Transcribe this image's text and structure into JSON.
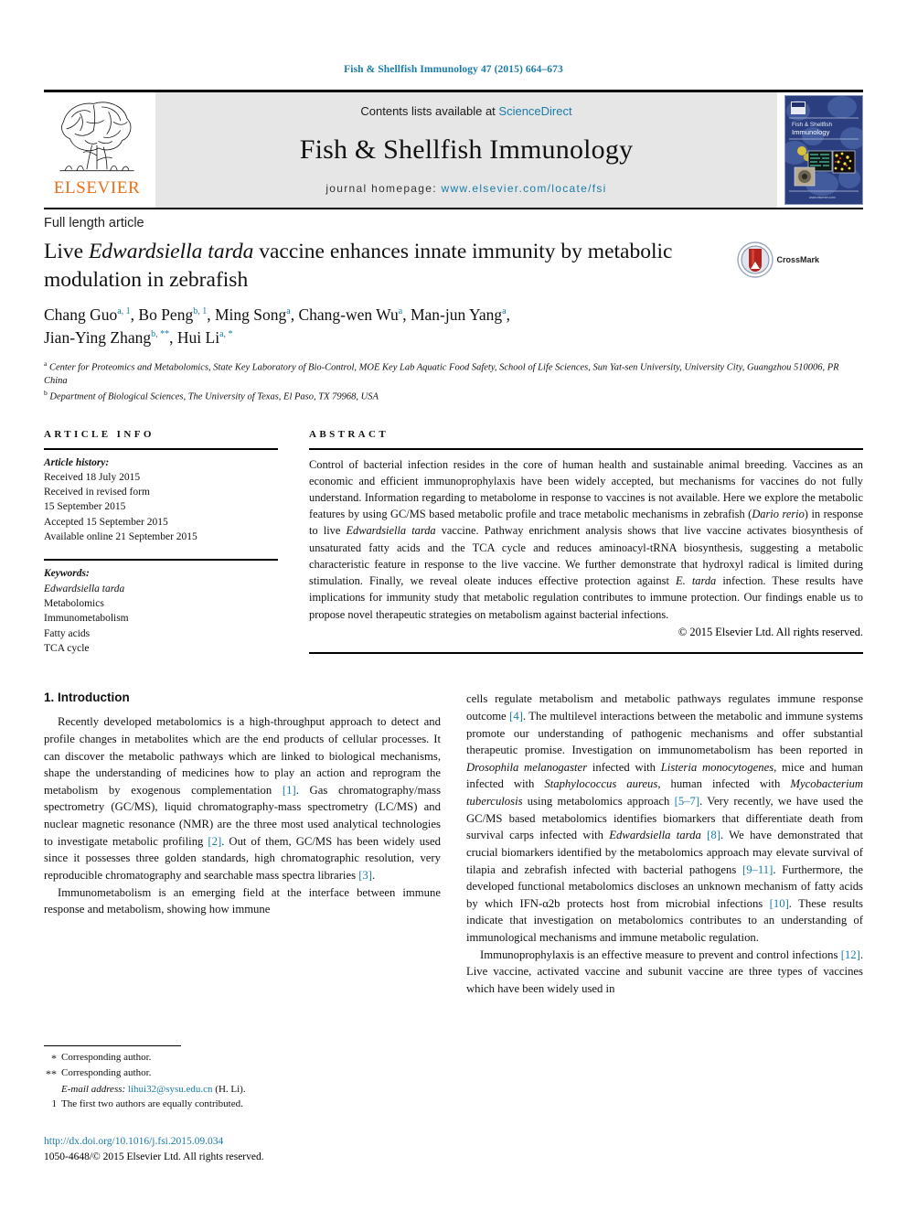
{
  "running_head": "Fish & Shellfish Immunology 47 (2015) 664–673",
  "masthead": {
    "publisher": "ELSEVIER",
    "contents_prefix": "Contents lists available at ",
    "contents_link": "ScienceDirect",
    "journal_title": "Fish & Shellfish Immunology",
    "homepage_prefix": "journal homepage: ",
    "homepage_link": "www.elsevier.com/locate/fsi",
    "cover_title_line1": "Fish & Shellfish",
    "cover_title_line2": "Immunology",
    "cover_footer": "www.elsevier.com"
  },
  "article": {
    "type": "Full length article",
    "title_part1": "Live ",
    "title_italic": "Edwardsiella tarda",
    "title_part2": " vaccine enhances innate immunity by metabolic modulation in zebrafish",
    "crossmark_label": "CrossMark",
    "authors": [
      {
        "name": "Chang Guo",
        "sup": "a, 1",
        "sep": ", "
      },
      {
        "name": "Bo Peng",
        "sup": "b, 1",
        "sep": ", "
      },
      {
        "name": "Ming Song",
        "sup": "a",
        "sep": ", "
      },
      {
        "name": "Chang-wen Wu",
        "sup": "a",
        "sep": ", "
      },
      {
        "name": "Man-jun Yang",
        "sup": "a",
        "sep": ", "
      },
      {
        "name": "Jian-Ying Zhang",
        "sup": "b, **",
        "sep": ", "
      },
      {
        "name": "Hui Li",
        "sup": "a, *",
        "sep": ""
      }
    ],
    "affiliations": [
      {
        "mark": "a",
        "text": "Center for Proteomics and Metabolomics, State Key Laboratory of Bio-Control, MOE Key Lab Aquatic Food Safety, School of Life Sciences, Sun Yat-sen University, University City, Guangzhou 510006, PR China"
      },
      {
        "mark": "b",
        "text": "Department of Biological Sciences, The University of Texas, El Paso, TX 79968, USA"
      }
    ]
  },
  "article_info": {
    "heading": "ARTICLE INFO",
    "history_label": "Article history:",
    "history_lines": [
      "Received 18 July 2015",
      "Received in revised form",
      "15 September 2015",
      "Accepted 15 September 2015",
      "Available online 21 September 2015"
    ],
    "keywords_label": "Keywords:",
    "keywords": [
      "Edwardsiella tarda",
      "Metabolomics",
      "Immunometabolism",
      "Fatty acids",
      "TCA cycle"
    ]
  },
  "abstract": {
    "heading": "ABSTRACT",
    "p1": "Control of bacterial infection resides in the core of human health and sustainable animal breeding. Vaccines as an economic and efficient immunoprophylaxis have been widely accepted, but mechanisms for vaccines do not fully understand. Information regarding to metabolome in response to vaccines is not available. Here we explore the metabolic features by using GC/MS based metabolic profile and trace metabolic mechanisms in zebrafish (",
    "italic1": "Dario rerio",
    "p2": ") in response to live ",
    "italic2": "Edwardsiella tarda",
    "p3": " vaccine. Pathway enrichment analysis shows that live vaccine activates biosynthesis of unsaturated fatty acids and the TCA cycle and reduces aminoacyl-tRNA biosynthesis, suggesting a metabolic characteristic feature in response to the live vaccine. We further demonstrate that hydroxyl radical is limited during stimulation. Finally, we reveal oleate induces effective protection against ",
    "italic3": "E. tarda",
    "p4": " infection. These results have implications for immunity study that metabolic regulation contributes to immune protection. Our findings enable us to propose novel therapeutic strategies on metabolism against bacterial infections.",
    "copyright": "© 2015 Elsevier Ltd. All rights reserved."
  },
  "body": {
    "section_number_title": "1. Introduction",
    "left_p1_a": "Recently developed metabolomics is a high-throughput approach to detect and profile changes in metabolites which are the end products of cellular processes. It can discover the metabolic pathways which are linked to biological mechanisms, shape the understanding of medicines how to play an action and reprogram the metabolism by exogenous complementation ",
    "left_ref1": "[1]",
    "left_p1_b": ". Gas chromatography/mass spectrometry (GC/MS), liquid chromatography-mass spectrometry (LC/MS) and nuclear magnetic resonance (NMR) are the three most used analytical technologies to investigate metabolic profiling ",
    "left_ref2": "[2]",
    "left_p1_c": ". Out of them, GC/MS has been widely used since it possesses three golden standards, high chromatographic resolution, very reproducible chromatography and searchable mass spectra libraries ",
    "left_ref3": "[3]",
    "left_p1_d": ".",
    "left_p2_a": "Immunometabolism is an emerging field at the interface between immune response and metabolism, showing how immune",
    "right_p1_a": "cells regulate metabolism and metabolic pathways regulates immune response outcome ",
    "right_ref4": "[4]",
    "right_p1_b": ". The multilevel interactions between the metabolic and immune systems promote our understanding of pathogenic mechanisms and offer substantial therapeutic promise. Investigation on immunometabolism has been reported in ",
    "right_it1": "Drosophila melanogaster",
    "right_p1_c": " infected with ",
    "right_it2": "Listeria monocytogenes",
    "right_p1_d": ", mice and human infected with ",
    "right_it3": "Staphylococcus aureus",
    "right_p1_e": ", human infected with ",
    "right_it4": "Mycobacterium tuberculosis",
    "right_p1_f": " using metabolomics approach ",
    "right_ref5": "[5–7]",
    "right_p1_g": ". Very recently, we have used the GC/MS based metabolomics identifies biomarkers that differentiate death from survival carps infected with ",
    "right_it5": "Edwardsiella tarda",
    "right_p1_h": " ",
    "right_ref8": "[8]",
    "right_p1_i": ". We have demonstrated that crucial biomarkers identified by the metabolomics approach may elevate survival of tilapia and zebrafish infected with bacterial pathogens ",
    "right_ref9": "[9–11]",
    "right_p1_j": ". Furthermore, the developed functional metabolomics discloses an unknown mechanism of fatty acids by which IFN-α2b protects host from microbial infections ",
    "right_ref10": "[10]",
    "right_p1_k": ". These results indicate that investigation on metabolomics contributes to an understanding of immunological mechanisms and immune metabolic regulation.",
    "right_p2_a": "Immunoprophylaxis is an effective measure to prevent and control infections ",
    "right_ref12": "[12]",
    "right_p2_b": ". Live vaccine, activated vaccine and subunit vaccine are three types of vaccines which have been widely used in"
  },
  "footnotes": {
    "star_mark": "*",
    "star_text": "Corresponding author.",
    "dstar_mark": "**",
    "dstar_text": "Corresponding author.",
    "email_label": "E-mail address:",
    "email": "lihui32@sysu.edu.cn",
    "email_suffix": " (H. Li).",
    "one_mark": "1",
    "one_text": "The first two authors are equally contributed."
  },
  "doi": {
    "url": "http://dx.doi.org/10.1016/j.fsi.2015.09.034",
    "issn_line": "1050-4648/© 2015 Elsevier Ltd. All rights reserved."
  },
  "colors": {
    "link": "#1a7ca8",
    "elsevier_orange": "#E9711C",
    "band_gray": "#e6e6e6",
    "cover_blue": "#2b3f80"
  }
}
